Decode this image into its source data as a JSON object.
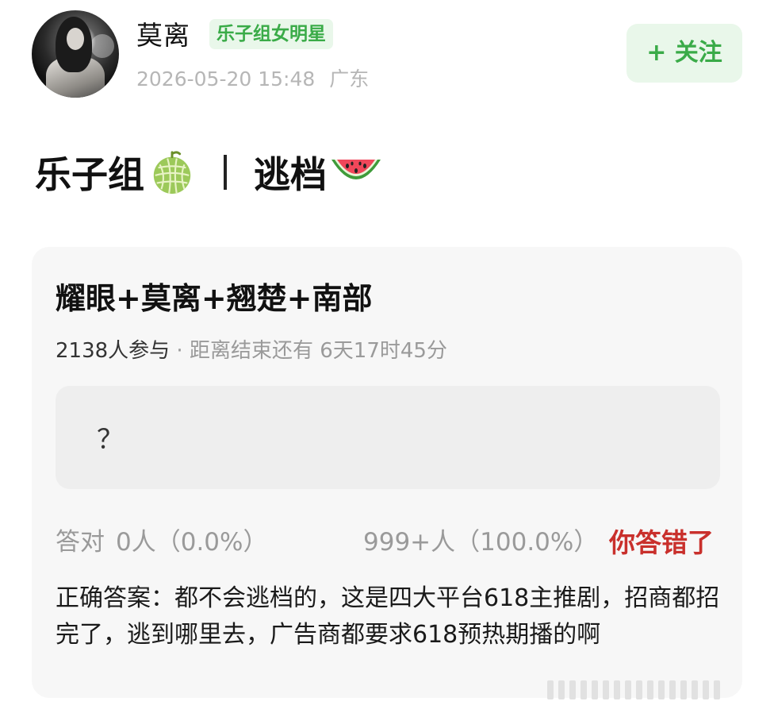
{
  "author": {
    "name": "莫离",
    "badge": "乐子组女明星",
    "time": "2026-05-20 15:48",
    "location": "广东",
    "follow_label": "+ 关注"
  },
  "post": {
    "title_part1": "乐子组",
    "title_part2": "逃档",
    "icons": [
      "melon-icon",
      "watermelon-icon"
    ]
  },
  "quiz": {
    "question": "耀眼+莫离+翘楚+南部",
    "participants": "2138人参与",
    "separator": " · ",
    "deadline": "距离结束还有 6天17时45分",
    "answer_placeholder": "？",
    "correct_label": "答对",
    "correct_stat": "0人（0.0%）",
    "wrong_stat": "999+人（100.0%）",
    "result": "你答错了",
    "explanation": "正确答案：都不会逃档的，这是四大平台618主推剧，招商都招完了，逃到哪里去，广告商都要求618预热期播的啊"
  },
  "colors": {
    "accent_green": "#3aab48",
    "accent_green_bg": "#e9f7ea",
    "wrong_red": "#c9302c"
  }
}
